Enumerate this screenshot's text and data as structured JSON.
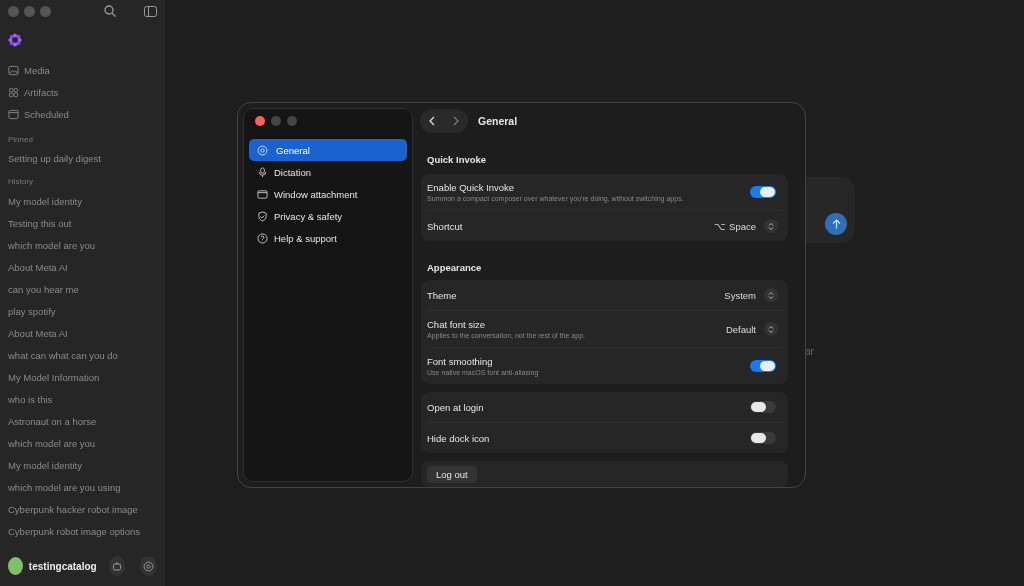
{
  "sidebar": {
    "nav": [
      {
        "label": "Media"
      },
      {
        "label": "Artifacts"
      },
      {
        "label": "Scheduled"
      }
    ],
    "pinned_heading": "Pinned",
    "pinned": [
      "Setting up daily digest"
    ],
    "history_heading": "History",
    "history": [
      "My model identity",
      "Testing this out",
      "which model are you",
      "About Meta AI",
      "can you hear me",
      "play spotify",
      "About Meta AI",
      "what can what can you do",
      "My Model Information",
      "who is this",
      "Astronaut on a horse",
      "which model are you",
      "My model identity",
      "which model are you using",
      "Cyberpunk hacker robot image",
      "Cyberpunk robot image options"
    ],
    "user": {
      "name": "testingcatalog"
    }
  },
  "background_text": "ar",
  "settings": {
    "title": "General",
    "nav": [
      {
        "label": "General",
        "selected": true
      },
      {
        "label": "Dictation",
        "selected": false
      },
      {
        "label": "Window attachment",
        "selected": false
      },
      {
        "label": "Privacy & safety",
        "selected": false
      },
      {
        "label": "Help & support",
        "selected": false
      }
    ],
    "sections": [
      {
        "heading": "Quick Invoke",
        "rows": [
          {
            "kind": "toggle",
            "label": "Enable Quick Invoke",
            "description": "Summon a compact composer over whatever you're doing, without switching apps.",
            "on": true
          },
          {
            "kind": "select",
            "label": "Shortcut",
            "value": "⌥ Space"
          }
        ]
      },
      {
        "heading": "Appearance",
        "rows": [
          {
            "kind": "select",
            "label": "Theme",
            "value": "System"
          },
          {
            "kind": "select",
            "label": "Chat font size",
            "description": "Applies to the conversation, not the rest of the app.",
            "value": "Default"
          },
          {
            "kind": "toggle",
            "label": "Font smoothing",
            "description": "Use native macOS font anti-aliasing",
            "on": true
          }
        ]
      },
      {
        "rows": [
          {
            "kind": "toggle",
            "label": "Open at login",
            "on": false
          },
          {
            "kind": "toggle",
            "label": "Hide dock icon",
            "on": false
          }
        ]
      },
      {
        "rows": [
          {
            "kind": "button",
            "label": "Log out"
          }
        ]
      }
    ]
  }
}
